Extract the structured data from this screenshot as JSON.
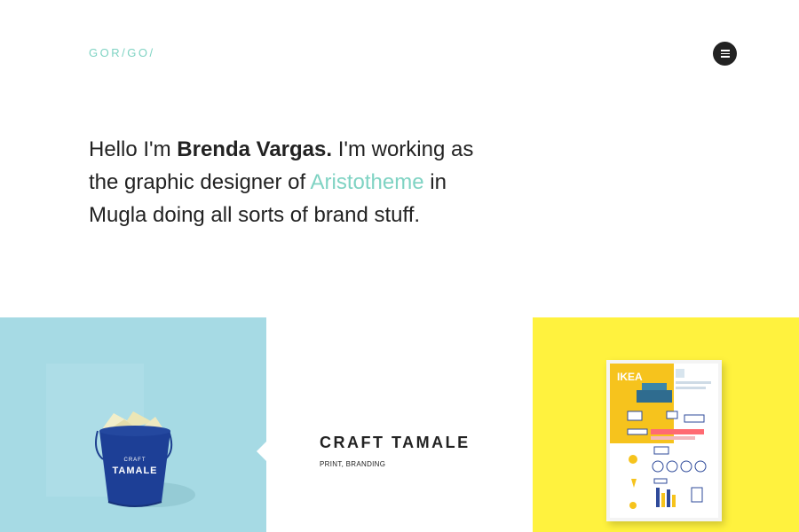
{
  "header": {
    "logo": "GOR/GO/",
    "menu_icon": "hamburger-icon"
  },
  "intro": {
    "greeting": "Hello I'm ",
    "name": "Brenda Vargas.",
    "middle": " I'm working as the graphic designer of ",
    "company": "Aristotheme",
    "tail": " in Mugla doing all sorts of brand stuff."
  },
  "project": {
    "title": "CRAFT TAMALE",
    "tags": "PRINT, BRANDING",
    "bucket_label_top": "CRAFT",
    "bucket_label_main": "TAMALE",
    "poster_title": "IKEA"
  },
  "colors": {
    "accent": "#7fd3c3",
    "tile_left": "#a6dae4",
    "tile_right": "#fff23e",
    "text": "#222222"
  }
}
